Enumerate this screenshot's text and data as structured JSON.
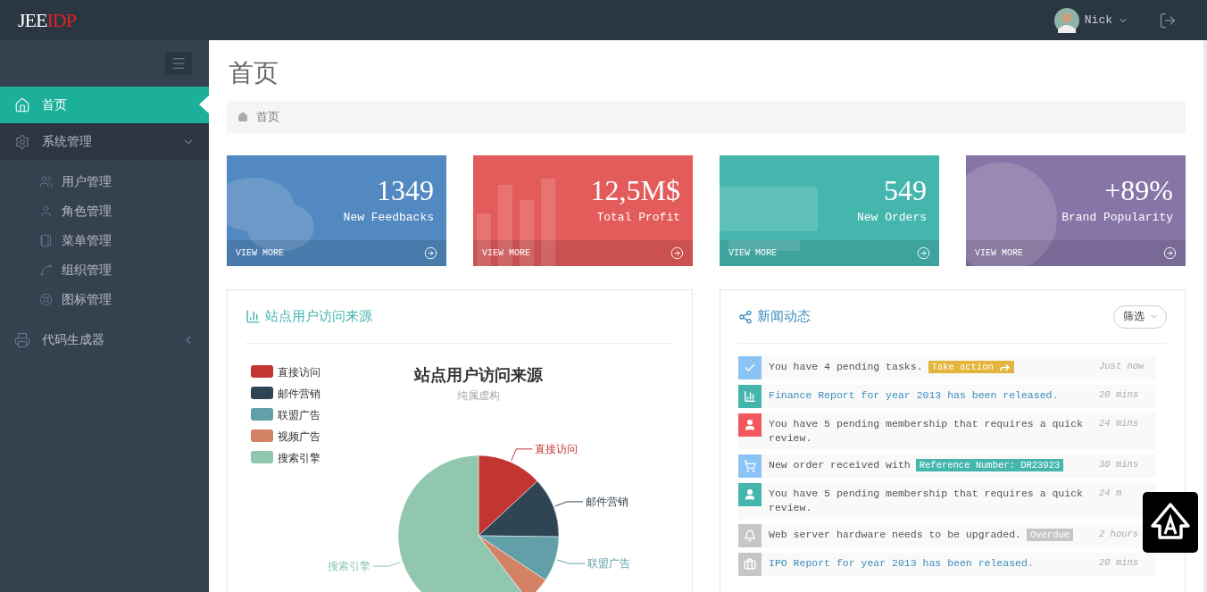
{
  "header": {
    "logo": {
      "part_1": "JEE",
      "part_2": "IDP"
    },
    "user": {
      "name": "Nick"
    }
  },
  "sidebar": {
    "items": [
      {
        "label": "首页",
        "selected": true,
        "expanded": false
      },
      {
        "label": "系统管理",
        "selected": false,
        "expanded": true,
        "children": [
          {
            "label": "用户管理"
          },
          {
            "label": "角色管理"
          },
          {
            "label": "菜单管理"
          },
          {
            "label": "组织管理"
          },
          {
            "label": "图标管理"
          }
        ]
      },
      {
        "label": "代码生成器",
        "selected": false,
        "expanded": false
      }
    ]
  },
  "page": {
    "title": "首页",
    "breadcrumb": [
      "首页"
    ]
  },
  "stats": [
    {
      "value": "1349",
      "label": "New Feedbacks",
      "link": "VIEW MORE",
      "color": "#5189c0"
    },
    {
      "value": "12,5M$",
      "label": "Total Profit",
      "link": "VIEW MORE",
      "color": "#e35b5a"
    },
    {
      "value": "549",
      "label": "New Orders",
      "link": "VIEW MORE",
      "color": "#44b6ae"
    },
    {
      "value": "+89%",
      "label": "Brand Popularity",
      "link": "VIEW MORE",
      "color": "#8775a7"
    }
  ],
  "chart_panel": {
    "title": "站点用户访问来源",
    "chart_data": {
      "type": "pie",
      "title": "站点用户访问来源",
      "subtitle": "纯属虚构",
      "legend": true,
      "categories": [
        "直接访问",
        "邮件营销",
        "联盟广告",
        "视频广告",
        "搜索引擎"
      ],
      "series": [
        {
          "colors": [
            "#c23531",
            "#2f4554",
            "#61a0a8",
            "#d48265",
            "#91c7ae"
          ],
          "values": [
            13.1,
            12.1,
            9.1,
            5.3,
            60.4
          ]
        }
      ]
    }
  },
  "news_panel": {
    "title": "新闻动态",
    "filter": "筛选",
    "items": [
      {
        "kind": "text",
        "text": "You have 4 pending tasks.",
        "tag": {
          "label": "Take action",
          "kind": "action",
          "color": "#e3b53c"
        },
        "time": "Just now",
        "color": "#89c4f4"
      },
      {
        "kind": "link",
        "text": "Finance Report for year 2013 has been released.",
        "time": "20 mins",
        "color": "#44b6ae"
      },
      {
        "kind": "text",
        "text": "You have 5 pending membership that requires a quick review.",
        "time": "24 mins",
        "color": "#f3565d"
      },
      {
        "kind": "text",
        "text": "New order received with",
        "tag": {
          "label": "Reference Number: DR23923",
          "kind": "label",
          "color": "#44b6ae"
        },
        "time": "30 mins",
        "color": "#89c4f4"
      },
      {
        "kind": "text",
        "text": "You have 5 pending membership that requires a quick review.",
        "time": "24 m",
        "color": "#44b6ae"
      },
      {
        "kind": "text",
        "text": "Web server hardware needs to be upgraded.",
        "tag": {
          "label": "Overdue",
          "kind": "label",
          "color": "#c6c6c6"
        },
        "time": "2 hours",
        "color": "#c6c6c6"
      },
      {
        "kind": "link",
        "text": "IPO Report for year 2013 has been released.",
        "time": "20 mins",
        "color": "#c6c6c6"
      }
    ]
  }
}
